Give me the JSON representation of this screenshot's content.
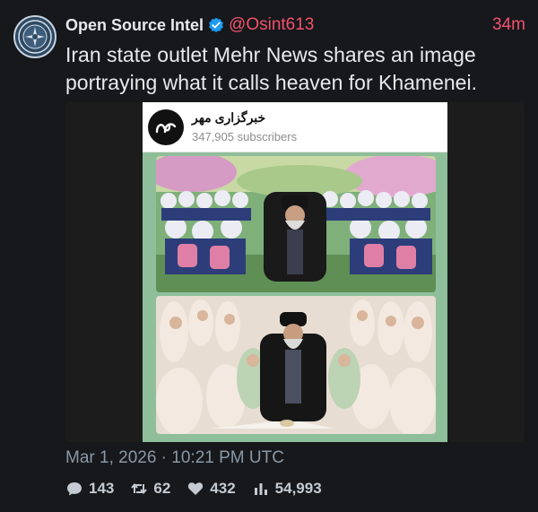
{
  "author": {
    "name": "Open Source Intel",
    "handle": "@Osint613",
    "verified": true,
    "avatar_icon": "osint-seal-icon"
  },
  "time_ago": "34m",
  "text": "Iran state outlet Mehr News shares an image portraying what it calls heaven for Khamenei.",
  "media": {
    "channel_name": "خبرگزاری مهر",
    "channel_subscribers": "347,905 subscribers",
    "channel_logo_icon": "mehr-logo-icon"
  },
  "timestamp": "Mar 1, 2026 · 10:21 PM UTC",
  "stats": {
    "replies": "143",
    "reposts": "62",
    "likes": "432",
    "views": "54,993"
  },
  "colors": {
    "background": "#16181c",
    "accent": "#f4516c",
    "verified": "#1d9bf0",
    "muted": "#8b98a5"
  }
}
